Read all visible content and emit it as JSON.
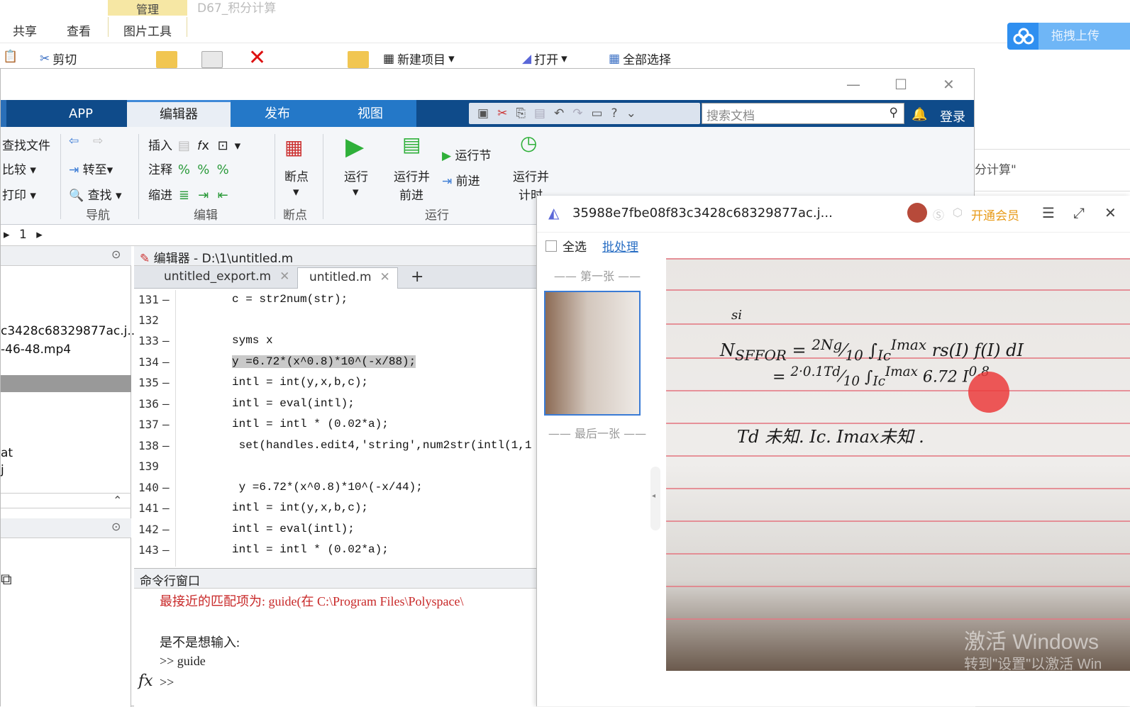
{
  "explorer": {
    "context_tab": "管理",
    "title": "D67_积分计算",
    "tabs": [
      "共享",
      "查看",
      "图片工具"
    ],
    "cut": "剪切",
    "new_item": "新建项目",
    "open": "打开",
    "select_all": "全部选择",
    "upload": "拖拽上传",
    "side_text": "分计算\""
  },
  "matlab": {
    "tabs": [
      "APP",
      "编辑器",
      "发布",
      "视图"
    ],
    "search_placeholder": "搜索文档",
    "login": "登录",
    "ribbon": {
      "find_files": "查找文件",
      "compare": "比较",
      "print": "打印",
      "goto": "转至",
      "find": "查找",
      "nav_label": "导航",
      "insert": "插入",
      "comment": "注释",
      "indent": "缩进",
      "edit_label": "编辑",
      "breakpoints": "断点",
      "breakpoints_label": "断点",
      "run": "运行",
      "run_advance_1": "运行并",
      "run_advance_2": "前进",
      "run_section": "运行节",
      "advance": "前进",
      "run_time_1": "运行并",
      "run_time_2": "计时",
      "run_label": "运行"
    },
    "path": "1",
    "left_files": [
      "c3428c68329877ac.j...",
      "-46-48.mp4",
      "at",
      "j"
    ],
    "editor_title": "编辑器 - D:\\1\\untitled.m",
    "editor_tabs": [
      "untitled_export.m",
      "untitled.m"
    ],
    "code": [
      {
        "n": "131",
        "t": "c = str2num(str);"
      },
      {
        "n": "132",
        "t": ""
      },
      {
        "n": "133",
        "t": "syms x"
      },
      {
        "n": "134",
        "t": "y =6.72*(x^0.8)*10^(-x/88);"
      },
      {
        "n": "135",
        "t": "intl = int(y,x,b,c);"
      },
      {
        "n": "136",
        "t": "intl = eval(intl);"
      },
      {
        "n": "137",
        "t": "intl = intl * (0.02*a);"
      },
      {
        "n": "138",
        "t": " set(handles.edit4,'string',num2str(intl(1,1"
      },
      {
        "n": "139",
        "t": ""
      },
      {
        "n": "140",
        "t": " y =6.72*(x^0.8)*10^(-x/44);"
      },
      {
        "n": "141",
        "t": "intl = int(y,x,b,c);"
      },
      {
        "n": "142",
        "t": "intl = eval(intl);"
      },
      {
        "n": "143",
        "t": "intl = intl * (0.02*a);"
      }
    ],
    "cmd_title": "命令行窗口",
    "cmd_lines": [
      "最接近的匹配项为: guide(在 C:\\Program Files\\Polyspace\\",
      "是不是想输入:",
      ">> guide",
      ">>"
    ]
  },
  "viewer": {
    "filename": "35988e7fbe08f83c3428c68329877ac.j...",
    "vip": "开通会员",
    "select_all": "全选",
    "batch": "批处理",
    "first": "第一张",
    "last": "最后一张"
  },
  "watermark": {
    "line1": "激活 Windows",
    "line2": "转到\"设置\"以激活 Win"
  }
}
